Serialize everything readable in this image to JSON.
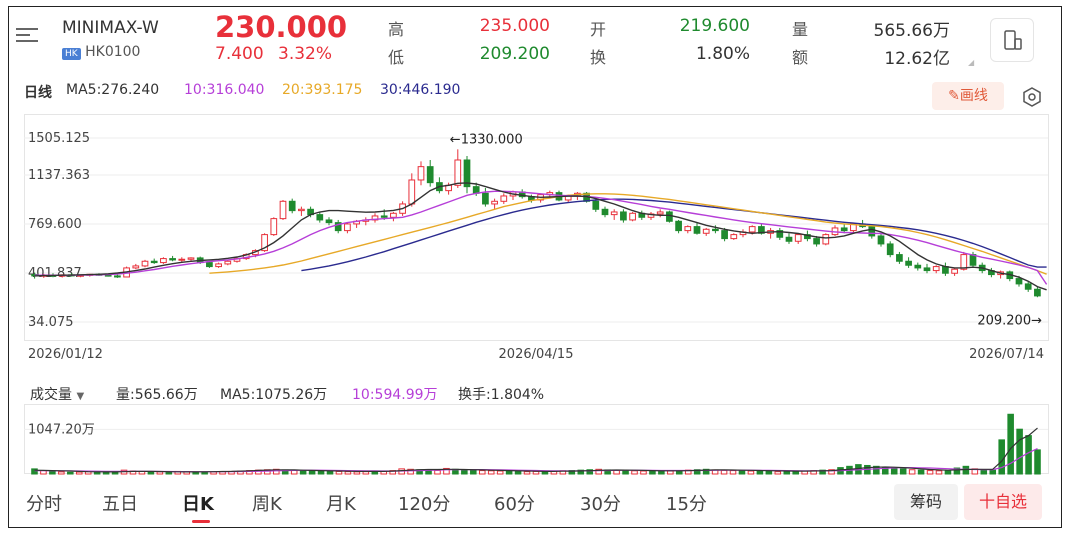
{
  "header": {
    "name": "MINIMAX-W",
    "market_badge": "HK",
    "code": "HK0100",
    "price": "230.000",
    "change": "7.400",
    "change_pct": "3.32%",
    "stats": [
      {
        "label": "高",
        "value": "235.000",
        "color": "red"
      },
      {
        "label": "开",
        "value": "219.600",
        "color": "green"
      },
      {
        "label": "量",
        "value": "565.66万",
        "color": "dark"
      },
      {
        "label": "低",
        "value": "209.200",
        "color": "green"
      },
      {
        "label": "换",
        "value": "1.80%",
        "color": "dark"
      },
      {
        "label": "额",
        "value": "12.62亿",
        "color": "dark"
      }
    ]
  },
  "indicators": {
    "period": "日线",
    "ma5": "MA5:276.240",
    "ma10": "10:316.040",
    "ma20": "20:393.175",
    "ma30": "30:446.190",
    "draw_label": "画线"
  },
  "colors": {
    "up": "#e8303a",
    "down": "#1f8a2e",
    "ma5": "#333333",
    "ma10": "#b63fd8",
    "ma20": "#e7a928",
    "ma30": "#2b2b8f"
  },
  "chart_data": {
    "type": "candlestick",
    "y_ticks": [
      "1505.125",
      "1137.363",
      "769.600",
      "401.837",
      "34.075"
    ],
    "ylim": [
      34.075,
      1505.125
    ],
    "x_ticks": [
      "2026/01/12",
      "2026/04/15",
      "2026/07/14"
    ],
    "annotations": {
      "high": "←1330.000",
      "low": "209.200→"
    },
    "high_value": 1330.0,
    "low_value": 209.2,
    "candles": [
      [
        390,
        405,
        360,
        380
      ],
      [
        380,
        395,
        365,
        385
      ],
      [
        385,
        400,
        370,
        378
      ],
      [
        378,
        392,
        368,
        388
      ],
      [
        388,
        400,
        375,
        380
      ],
      [
        380,
        390,
        370,
        385
      ],
      [
        385,
        395,
        375,
        392
      ],
      [
        392,
        400,
        380,
        386
      ],
      [
        386,
        395,
        375,
        380
      ],
      [
        380,
        390,
        365,
        372
      ],
      [
        372,
        450,
        370,
        440
      ],
      [
        440,
        470,
        430,
        455
      ],
      [
        455,
        500,
        445,
        490
      ],
      [
        490,
        510,
        470,
        480
      ],
      [
        480,
        520,
        470,
        510
      ],
      [
        510,
        530,
        490,
        500
      ],
      [
        500,
        520,
        480,
        505
      ],
      [
        505,
        520,
        490,
        515
      ],
      [
        515,
        525,
        470,
        480
      ],
      [
        480,
        490,
        440,
        450
      ],
      [
        450,
        480,
        440,
        470
      ],
      [
        470,
        500,
        460,
        490
      ],
      [
        490,
        520,
        480,
        510
      ],
      [
        510,
        550,
        500,
        540
      ],
      [
        540,
        580,
        520,
        570
      ],
      [
        570,
        700,
        560,
        690
      ],
      [
        690,
        820,
        680,
        810
      ],
      [
        810,
        950,
        800,
        940
      ],
      [
        940,
        960,
        850,
        870
      ],
      [
        870,
        900,
        830,
        880
      ],
      [
        880,
        900,
        820,
        840
      ],
      [
        840,
        860,
        780,
        800
      ],
      [
        800,
        820,
        760,
        780
      ],
      [
        780,
        800,
        700,
        720
      ],
      [
        720,
        780,
        700,
        770
      ],
      [
        770,
        800,
        740,
        790
      ],
      [
        790,
        820,
        760,
        800
      ],
      [
        800,
        850,
        780,
        830
      ],
      [
        830,
        880,
        800,
        820
      ],
      [
        820,
        860,
        790,
        850
      ],
      [
        850,
        940,
        830,
        920
      ],
      [
        920,
        1150,
        900,
        1100
      ],
      [
        1100,
        1240,
        1060,
        1200
      ],
      [
        1200,
        1250,
        1050,
        1080
      ],
      [
        1080,
        1120,
        1000,
        1020
      ],
      [
        1020,
        1080,
        990,
        1060
      ],
      [
        1060,
        1330,
        1040,
        1250
      ],
      [
        1250,
        1280,
        1000,
        1050
      ],
      [
        1050,
        1080,
        980,
        1000
      ],
      [
        1000,
        1040,
        900,
        920
      ],
      [
        920,
        960,
        880,
        940
      ],
      [
        940,
        1000,
        920,
        980
      ],
      [
        980,
        1020,
        950,
        1010
      ],
      [
        1010,
        1030,
        960,
        975
      ],
      [
        975,
        990,
        930,
        950
      ],
      [
        950,
        1000,
        930,
        990
      ],
      [
        990,
        1020,
        960,
        1005
      ],
      [
        1005,
        1020,
        940,
        950
      ],
      [
        950,
        990,
        930,
        980
      ],
      [
        980,
        1010,
        950,
        1000
      ],
      [
        1000,
        1010,
        930,
        940
      ],
      [
        940,
        960,
        860,
        880
      ],
      [
        880,
        900,
        820,
        840
      ],
      [
        840,
        880,
        800,
        860
      ],
      [
        860,
        880,
        780,
        800
      ],
      [
        800,
        860,
        790,
        850
      ],
      [
        850,
        870,
        800,
        820
      ],
      [
        820,
        860,
        800,
        845
      ],
      [
        845,
        880,
        820,
        860
      ],
      [
        860,
        870,
        780,
        790
      ],
      [
        790,
        800,
        700,
        720
      ],
      [
        720,
        760,
        700,
        750
      ],
      [
        750,
        780,
        690,
        700
      ],
      [
        700,
        740,
        680,
        730
      ],
      [
        730,
        760,
        700,
        720
      ],
      [
        720,
        740,
        640,
        660
      ],
      [
        660,
        700,
        650,
        690
      ],
      [
        690,
        730,
        670,
        710
      ],
      [
        710,
        760,
        690,
        750
      ],
      [
        750,
        770,
        690,
        700
      ],
      [
        700,
        740,
        660,
        720
      ],
      [
        720,
        740,
        650,
        670
      ],
      [
        670,
        700,
        620,
        640
      ],
      [
        640,
        700,
        620,
        690
      ],
      [
        690,
        720,
        640,
        660
      ],
      [
        660,
        680,
        600,
        620
      ],
      [
        620,
        700,
        610,
        690
      ],
      [
        690,
        760,
        680,
        740
      ],
      [
        740,
        770,
        700,
        720
      ],
      [
        720,
        780,
        700,
        770
      ],
      [
        770,
        800,
        740,
        750
      ],
      [
        750,
        760,
        660,
        680
      ],
      [
        680,
        700,
        600,
        620
      ],
      [
        620,
        640,
        520,
        540
      ],
      [
        540,
        560,
        470,
        490
      ],
      [
        490,
        520,
        440,
        460
      ],
      [
        460,
        480,
        420,
        440
      ],
      [
        440,
        470,
        400,
        420
      ],
      [
        420,
        460,
        400,
        450
      ],
      [
        450,
        480,
        380,
        400
      ],
      [
        400,
        440,
        380,
        430
      ],
      [
        430,
        560,
        420,
        540
      ],
      [
        540,
        560,
        440,
        460
      ],
      [
        460,
        480,
        400,
        420
      ],
      [
        420,
        440,
        370,
        390
      ],
      [
        390,
        420,
        360,
        410
      ],
      [
        410,
        420,
        340,
        360
      ],
      [
        360,
        380,
        300,
        320
      ],
      [
        320,
        340,
        260,
        280
      ],
      [
        280,
        300,
        220,
        230
      ]
    ],
    "ma5": [
      380,
      382,
      384,
      385,
      386,
      388,
      390,
      392,
      396,
      402,
      410,
      420,
      432,
      446,
      460,
      472,
      482,
      490,
      496,
      500,
      505,
      512,
      522,
      538,
      560,
      590,
      630,
      680,
      740,
      800,
      840,
      860,
      870,
      870,
      866,
      862,
      858,
      860,
      866,
      872,
      885,
      920,
      970,
      1020,
      1050,
      1060,
      1075,
      1078,
      1070,
      1050,
      1030,
      1010,
      995,
      985,
      975,
      970,
      972,
      975,
      978,
      980,
      975,
      960,
      940,
      920,
      895,
      870,
      850,
      840,
      835,
      835,
      820,
      800,
      780,
      760,
      745,
      730,
      718,
      708,
      700,
      705,
      710,
      712,
      706,
      698,
      685,
      672,
      665,
      670,
      680,
      700,
      718,
      730,
      710,
      680,
      640,
      590,
      540,
      500,
      470,
      450,
      440,
      440,
      445,
      440,
      420,
      400,
      390,
      370,
      340,
      300,
      276
    ],
    "ma10": [
      385,
      385,
      385,
      385,
      385,
      386,
      387,
      388,
      390,
      394,
      400,
      408,
      418,
      428,
      440,
      452,
      462,
      472,
      480,
      488,
      494,
      500,
      508,
      518,
      530,
      545,
      565,
      590,
      620,
      655,
      690,
      720,
      745,
      765,
      780,
      790,
      800,
      805,
      810,
      815,
      820,
      838,
      860,
      885,
      910,
      935,
      960,
      985,
      1000,
      1010,
      1015,
      1015,
      1012,
      1008,
      1002,
      996,
      990,
      985,
      982,
      980,
      976,
      970,
      962,
      952,
      940,
      928,
      915,
      902,
      890,
      880,
      868,
      856,
      845,
      834,
      822,
      812,
      800,
      790,
      780,
      772,
      764,
      756,
      748,
      740,
      732,
      724,
      716,
      710,
      706,
      704,
      702,
      700,
      698,
      690,
      678,
      664,
      648,
      630,
      610,
      590,
      570,
      552,
      536,
      520,
      506,
      492,
      478,
      462,
      444,
      420,
      316
    ],
    "ma20": [
      null,
      null,
      null,
      null,
      null,
      null,
      null,
      null,
      null,
      null,
      null,
      null,
      null,
      null,
      null,
      null,
      null,
      null,
      null,
      400,
      405,
      410,
      416,
      423,
      431,
      440,
      450,
      462,
      476,
      492,
      510,
      528,
      546,
      564,
      582,
      600,
      618,
      636,
      654,
      672,
      690,
      708,
      726,
      744,
      762,
      780,
      800,
      820,
      840,
      860,
      880,
      900,
      915,
      930,
      945,
      955,
      965,
      975,
      985,
      990,
      994,
      996,
      996,
      994,
      990,
      985,
      978,
      970,
      962,
      954,
      944,
      934,
      924,
      914,
      904,
      894,
      884,
      874,
      864,
      854,
      844,
      834,
      824,
      814,
      804,
      794,
      784,
      776,
      770,
      765,
      760,
      756,
      750,
      742,
      732,
      720,
      706,
      690,
      672,
      652,
      630,
      608,
      586,
      564,
      540,
      516,
      492,
      468,
      444,
      420,
      393
    ],
    "ma30": [
      null,
      null,
      null,
      null,
      null,
      null,
      null,
      null,
      null,
      null,
      null,
      null,
      null,
      null,
      null,
      null,
      null,
      null,
      null,
      null,
      null,
      null,
      null,
      null,
      null,
      null,
      null,
      null,
      null,
      420,
      430,
      442,
      455,
      470,
      486,
      504,
      522,
      542,
      562,
      584,
      606,
      628,
      650,
      672,
      694,
      716,
      738,
      760,
      782,
      802,
      822,
      840,
      858,
      874,
      888,
      900,
      912,
      922,
      930,
      938,
      944,
      950,
      954,
      956,
      956,
      954,
      950,
      946,
      940,
      934,
      926,
      918,
      910,
      902,
      894,
      886,
      878,
      870,
      862,
      854,
      846,
      838,
      830,
      822,
      814,
      806,
      798,
      790,
      782,
      776,
      770,
      764,
      758,
      752,
      744,
      736,
      726,
      714,
      700,
      684,
      666,
      646,
      624,
      600,
      574,
      546,
      518,
      490,
      462,
      446,
      446
    ]
  },
  "volume": {
    "selector": "成交量",
    "vol": "量:565.66万",
    "ma5": "MA5:1075.26万",
    "ma10": "10:594.99万",
    "turnover": "换手:1.804%",
    "y_tick": "1047.20万",
    "ylim": [
      0,
      1500
    ],
    "bars": [
      120,
      80,
      60,
      50,
      40,
      45,
      55,
      60,
      50,
      45,
      90,
      70,
      60,
      55,
      50,
      45,
      60,
      55,
      40,
      45,
      50,
      55,
      60,
      70,
      80,
      90,
      100,
      110,
      95,
      85,
      80,
      75,
      70,
      65,
      60,
      55,
      50,
      55,
      60,
      70,
      80,
      120,
      110,
      100,
      90,
      85,
      130,
      110,
      95,
      90,
      80,
      75,
      70,
      65,
      60,
      55,
      60,
      65,
      70,
      75,
      80,
      90,
      100,
      110,
      95,
      85,
      80,
      75,
      70,
      65,
      60,
      70,
      80,
      90,
      100,
      110,
      95,
      85,
      80,
      75,
      70,
      65,
      60,
      55,
      60,
      65,
      70,
      80,
      90,
      100,
      150,
      180,
      220,
      200,
      180,
      160,
      140,
      120,
      100,
      90,
      80,
      75,
      70,
      140,
      180,
      120,
      100,
      90,
      800,
      1400,
      1050,
      900,
      565
    ],
    "ma5_line": [
      90,
      85,
      80,
      75,
      70,
      60,
      55,
      52,
      50,
      50,
      55,
      60,
      62,
      60,
      58,
      55,
      52,
      50,
      50,
      52,
      55,
      58,
      62,
      68,
      75,
      85,
      92,
      98,
      98,
      96,
      90,
      85,
      80,
      75,
      70,
      65,
      62,
      60,
      60,
      62,
      68,
      80,
      90,
      100,
      105,
      105,
      110,
      110,
      106,
      100,
      95,
      90,
      85,
      80,
      75,
      70,
      65,
      62,
      62,
      65,
      68,
      72,
      78,
      86,
      92,
      94,
      92,
      88,
      84,
      80,
      76,
      74,
      74,
      78,
      84,
      92,
      96,
      96,
      94,
      90,
      86,
      82,
      78,
      74,
      70,
      68,
      68,
      70,
      74,
      80,
      95,
      110,
      130,
      150,
      160,
      165,
      160,
      150,
      135,
      120,
      105,
      95,
      90,
      95,
      105,
      110,
      110,
      110,
      300,
      600,
      800,
      900,
      1075
    ],
    "ma10_line": [
      80,
      78,
      76,
      74,
      72,
      70,
      68,
      66,
      64,
      62,
      60,
      60,
      60,
      60,
      59,
      58,
      57,
      56,
      55,
      55,
      55,
      56,
      57,
      58,
      60,
      64,
      68,
      74,
      80,
      85,
      88,
      90,
      88,
      86,
      83,
      80,
      77,
      74,
      72,
      70,
      68,
      70,
      74,
      80,
      86,
      92,
      98,
      102,
      104,
      104,
      102,
      100,
      97,
      94,
      90,
      86,
      82,
      78,
      74,
      72,
      71,
      72,
      74,
      78,
      82,
      86,
      88,
      88,
      87,
      85,
      83,
      82,
      81,
      81,
      82,
      84,
      86,
      88,
      89,
      89,
      88,
      86,
      84,
      82,
      80,
      78,
      76,
      75,
      75,
      76,
      80,
      88,
      98,
      110,
      122,
      134,
      144,
      150,
      150,
      146,
      140,
      132,
      124,
      116,
      110,
      106,
      104,
      104,
      150,
      250,
      380,
      500,
      595
    ]
  },
  "tabs": [
    "分时",
    "五日",
    "日K",
    "周K",
    "月K",
    "120分",
    "60分",
    "30分",
    "15分"
  ],
  "active_tab": "日K",
  "buttons": {
    "chips": "筹码",
    "watchlist": "十自选"
  }
}
